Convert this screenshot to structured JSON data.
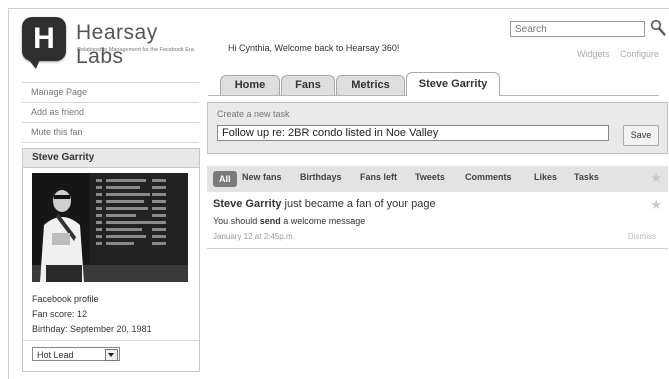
{
  "brand": {
    "name": "Hearsay Labs",
    "tagline": "Relationship Management for the Facebook Era",
    "logo_letter": "H"
  },
  "header": {
    "welcome": "Hi Cynthia, Welcome back to Hearsay 360!",
    "search_placeholder": "Search",
    "links": [
      "Widgets",
      "Configure"
    ]
  },
  "sidebar": {
    "links": [
      "Manage Page",
      "Add as friend",
      "Mute this fan"
    ]
  },
  "profile": {
    "name": "Steve Garrity",
    "info": [
      "Facebook profile",
      "Fan score: 12",
      "Birthday: September 20, 1981"
    ],
    "status_selected": "Hot Lead"
  },
  "tabs": [
    {
      "label": "Home"
    },
    {
      "label": "Fans"
    },
    {
      "label": "Metrics"
    },
    {
      "label": "Steve Garrity",
      "active": true
    }
  ],
  "task": {
    "label": "Create a new task",
    "value": "Follow up re: 2BR condo listed in Noe Valley",
    "save_label": "Save"
  },
  "filters": {
    "all_label": "All",
    "items": [
      "New fans",
      "Birthdays",
      "Fans left",
      "Tweets",
      "Comments",
      "Likes",
      "Tasks"
    ]
  },
  "feed": {
    "name": "Steve Garrity",
    "action": "just became a fan of your page",
    "sub_prefix": "You should",
    "sub_bold": "send",
    "sub_suffix": "a welcome message",
    "time": "January 12 at 2:45p.m.",
    "dismiss": "Dismiss"
  },
  "colors": {
    "tab_bg": "#dedede",
    "panel_bg": "#e9e9e9",
    "pill_bg": "#7a7a7a"
  },
  "icons": {
    "search": "search-icon",
    "star": "star-icon",
    "dropdown": "chevron-down-icon"
  }
}
